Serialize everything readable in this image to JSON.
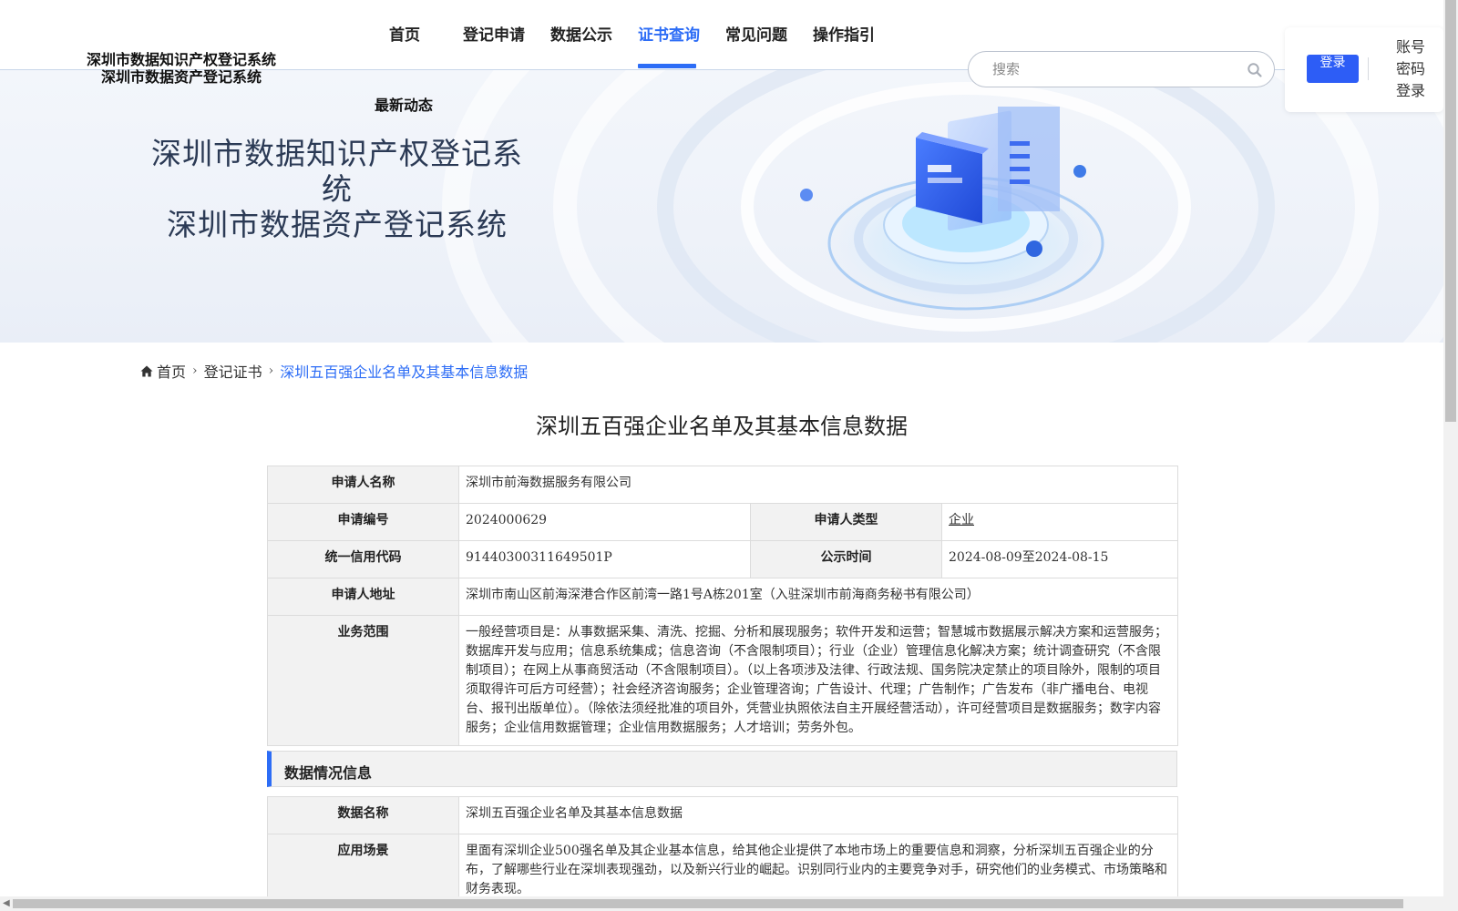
{
  "header": {
    "logo_line1": "深圳市数据知识产权登记系统",
    "logo_line2": "深圳市数据资产登记系统",
    "nav": [
      {
        "label": "首页",
        "active": false
      },
      {
        "label": "登记申请",
        "active": false
      },
      {
        "label": "数据公示",
        "active": false
      },
      {
        "label": "证书查询",
        "active": true
      },
      {
        "label": "常见问题",
        "active": false
      },
      {
        "label": "操作指引",
        "active": false
      }
    ],
    "news_link": "最新动态",
    "search_placeholder": "搜索",
    "login_button": "登录",
    "password_login": "账号密码登录"
  },
  "banner": {
    "title_line1": "深圳市数据知识产权登记系统",
    "title_line2": "深圳市数据资产登记系统"
  },
  "breadcrumb": {
    "home": "首页",
    "level2": "登记证书",
    "current": "深圳五百强企业名单及其基本信息数据"
  },
  "page_title": "深圳五百强企业名单及其基本信息数据",
  "applicant": {
    "name_label": "申请人名称",
    "name": "深圳市前海数据服务有限公司",
    "number_label": "申请编号",
    "number": "2024000629",
    "type_label": "申请人类型",
    "type": "企业",
    "credit_label": "统一信用代码",
    "credit": "91440300311649501P",
    "publicity_label": "公示时间",
    "publicity": "2024-08-09至2024-08-15",
    "address_label": "申请人地址",
    "address": "深圳市南山区前海深港合作区前湾一路1号A栋201室（入驻深圳市前海商务秘书有限公司）",
    "scope_label": "业务范围",
    "scope": "一般经营项目是：从事数据采集、清洗、挖掘、分析和展现服务；软件开发和运营；智慧城市数据展示解决方案和运营服务；数据库开发与应用；信息系统集成；信息咨询（不含限制项目）；行业（企业）管理信息化解决方案；统计调查研究（不含限制项目）；在网上从事商贸活动（不含限制项目）。（以上各项涉及法律、行政法规、国务院决定禁止的项目除外，限制的项目须取得许可后方可经营）；社会经济咨询服务；企业管理咨询；广告设计、代理；广告制作；广告发布（非广播电台、电视台、报刊出版单位）。（除依法须经批准的项目外，凭营业执照依法自主开展经营活动），许可经营项目是数据服务；数字内容服务；企业信用数据管理；企业信用数据服务；人才培训；劳务外包。"
  },
  "data_section": {
    "heading": "数据情况信息",
    "data_name_label": "数据名称",
    "data_name": "深圳五百强企业名单及其基本信息数据",
    "scenario_label": "应用场景",
    "scenario": "里面有深圳企业500强名单及其企业基本信息，给其他企业提供了本地市场上的重要信息和洞察，分析深圳五百强企业的分布，了解哪些行业在深圳表现强劲，以及新兴行业的崛起。识别同行业内的主要竞争对手，研究他们的业务模式、市场策略和财务表现。"
  },
  "colors": {
    "accent": "#2d6df6",
    "label_bg": "#f2f2f2",
    "border": "#dcdcdc"
  }
}
